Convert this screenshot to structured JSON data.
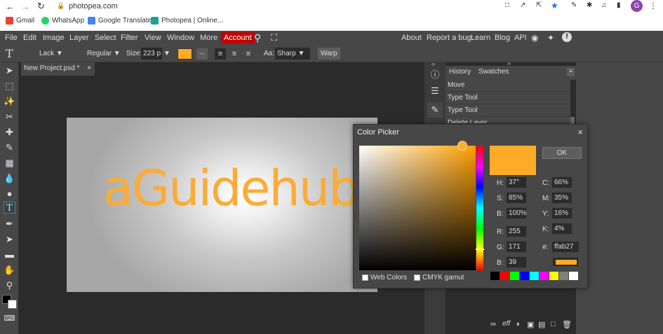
{
  "browser": {
    "url": "photopea.com",
    "bookmarks": [
      "Gmail",
      "WhatsApp",
      "Google Translate",
      "Photopea | Online..."
    ],
    "profile_initial": "G"
  },
  "menubar": {
    "items": [
      "File",
      "Edit",
      "Image",
      "Layer",
      "Select",
      "Filter",
      "View",
      "Window",
      "More"
    ],
    "account": "Account",
    "right_links": [
      "About",
      "Report a bug",
      "Learn",
      "Blog",
      "API"
    ]
  },
  "options": {
    "font": "Lack",
    "style": "Regular",
    "size_label": "Size:",
    "size_value": "223 p",
    "more": "...",
    "aa_label": "Aa:",
    "aa_value": "Sharp",
    "warp": "Warp",
    "text_color": "#ffab27"
  },
  "document": {
    "tab": "New Project.psd *",
    "close": "×",
    "canvas_text": "aGuidehub!"
  },
  "panel": {
    "tabs": [
      "History",
      "Swatches"
    ],
    "history": [
      "Move",
      "Type Tool",
      "Type Tool",
      "Delete Layer"
    ]
  },
  "picker": {
    "title": "Color Picker",
    "close": "×",
    "ok": "OK",
    "fields": {
      "H": "37°",
      "S": "85%",
      "B": "100%",
      "R": "255",
      "G": "171",
      "B2": "39",
      "C": "66%",
      "M": "35%",
      "Y": "16%",
      "K": "4%",
      "hex": "ffab27"
    },
    "labels": {
      "H": "H:",
      "S": "S:",
      "B": "B:",
      "R": "R:",
      "G": "G:",
      "B2": "B:",
      "C": "C:",
      "M": "M:",
      "Y": "Y:",
      "K": "K:",
      "hex": "#:"
    },
    "web_colors": "Web Colors",
    "cmyk_gamut": "CMYK gamut",
    "current_color": "#ffab27",
    "palette": [
      "#000000",
      "#ff0000",
      "#00ff00",
      "#0000ff",
      "#00ffff",
      "#ff00ff",
      "#ffff00",
      "#808080",
      "#ffffff"
    ]
  }
}
